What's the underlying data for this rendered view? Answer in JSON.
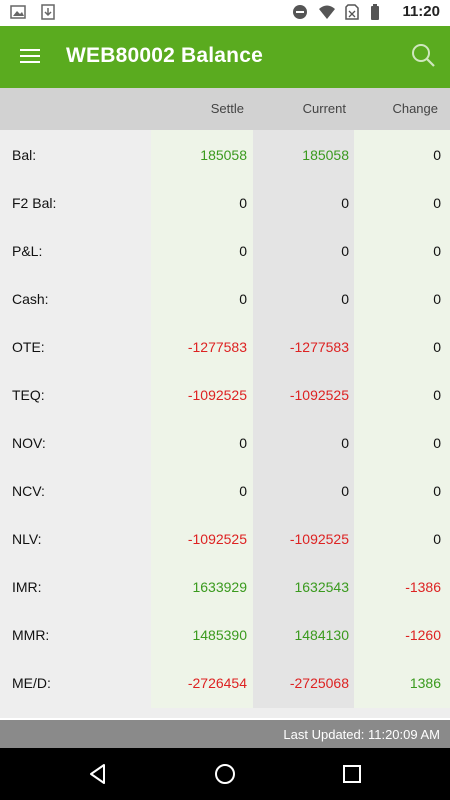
{
  "status_bar": {
    "time": "11:20"
  },
  "app_bar": {
    "title": "WEB80002 Balance"
  },
  "columns": {
    "settle": "Settle",
    "current": "Current",
    "change": "Change"
  },
  "rows": [
    {
      "label": "Bal:",
      "settle": "185058",
      "current": "185058",
      "change": "0"
    },
    {
      "label": "F2 Bal:",
      "settle": "0",
      "current": "0",
      "change": "0"
    },
    {
      "label": "P&L:",
      "settle": "0",
      "current": "0",
      "change": "0"
    },
    {
      "label": "Cash:",
      "settle": "0",
      "current": "0",
      "change": "0"
    },
    {
      "label": "OTE:",
      "settle": "-1277583",
      "current": "-1277583",
      "change": "0"
    },
    {
      "label": "TEQ:",
      "settle": "-1092525",
      "current": "-1092525",
      "change": "0"
    },
    {
      "label": "NOV:",
      "settle": "0",
      "current": "0",
      "change": "0"
    },
    {
      "label": "NCV:",
      "settle": "0",
      "current": "0",
      "change": "0"
    },
    {
      "label": "NLV:",
      "settle": "-1092525",
      "current": "-1092525",
      "change": "0"
    },
    {
      "label": "IMR:",
      "settle": "1633929",
      "current": "1632543",
      "change": "-1386"
    },
    {
      "label": "MMR:",
      "settle": "1485390",
      "current": "1484130",
      "change": "-1260"
    },
    {
      "label": "ME/D:",
      "settle": "-2726454",
      "current": "-2725068",
      "change": "1386"
    }
  ],
  "footer": {
    "last_updated": "Last Updated: 11:20:09 AM"
  },
  "colors": {
    "brand_green": "#5aab1f",
    "positive": "#3a9a1e",
    "negative": "#dd2222"
  }
}
